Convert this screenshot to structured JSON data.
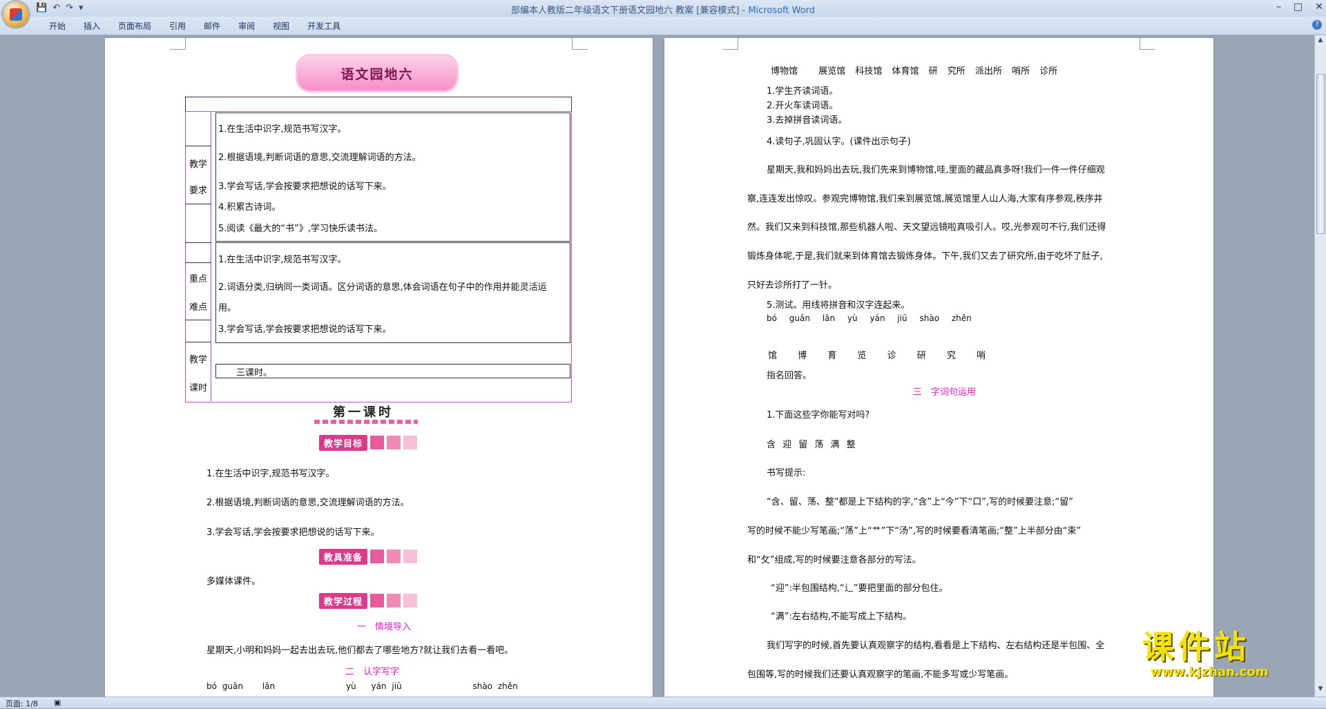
{
  "window": {
    "title": "部编本人教版二年级语文下册语文园地六 教案 [兼容模式]",
    "app": "Microsoft Word",
    "separator": "-",
    "controls": {
      "minimize": "–",
      "maximize": "□",
      "close": "✕"
    }
  },
  "quick_access": {
    "save": "💾",
    "undo": "↶",
    "redo": "↷",
    "customize": "▾"
  },
  "ribbon": {
    "tabs": [
      "开始",
      "插入",
      "页面布局",
      "引用",
      "邮件",
      "审阅",
      "视图",
      "开发工具"
    ],
    "help": "?"
  },
  "page1": {
    "banner": "语文园地六",
    "table": {
      "req_label_1": "教学",
      "req_label_2": "要求",
      "req_items": [
        "1.在生活中识字,规范书写汉字。",
        "2.根据语境,判断词语的意思,交流理解词语的方法。",
        "3.学会写话,学会按要求把想说的话写下来。",
        "4.积累古诗词。",
        "5.阅读《最大的“书”》,学习快乐读书法。"
      ],
      "key_label_1": "重点",
      "key_label_2": "难点",
      "key_items": [
        "1.在生活中识字,规范书写汉字。",
        "2.词语分类,归纳同一类词语。区分词语的意思,体会词语在句子中的作用并能灵活运",
        "用。",
        "3.学会写话,学会按要求把想说的话写下来。"
      ],
      "time_label_1": "教学",
      "time_label_2": "课时",
      "time_value": "三课时。"
    },
    "lesson_title": "第一课时",
    "tag_goal": "教学目标",
    "goals": [
      "1.在生活中识字,规范书写汉字。",
      "2.根据语境,判断词语的意思,交流理解词语的方法。",
      "3.学会写话,学会按要求把想说的话写下来。"
    ],
    "tag_prep": "教具准备",
    "prep": "多媒体课件。",
    "tag_process": "教学过程",
    "section1": "一　情境导入",
    "intro": "星期天,小明和妈妈一起去出去玩,他们都去了哪些地方?就让我们去看一看吧。",
    "section2": "二　认字写字",
    "pinyin": [
      "bó",
      "guǎn",
      "lǎn",
      "yù",
      "yán jiū",
      "shào",
      "zhěn"
    ]
  },
  "page2": {
    "places": [
      "博物馆",
      "展览馆",
      "科技馆",
      "体育馆",
      "研 究所",
      "派出所",
      "哨所",
      "诊所"
    ],
    "reads": [
      "1.学生齐读词语。",
      "2.开火车读词语。",
      "3.去掉拼音读词语。"
    ],
    "step4": "4.读句子,巩固认字。(课件出示句子)",
    "story": [
      "星期天,我和妈妈出去玩,我们先来到博物馆,哇,里面的藏品真多呀!我们一件一件仔细观",
      "察,连连发出惊叹。参观完博物馆,我们来到展览馆,展览馆里人山人海,大家有序参观,秩序井",
      "然。我们又来到科技馆,那些机器人啦、天文望远镜啦真吸引人。哎,光参观可不行,我们还得",
      "锻炼身体呢,于是,我们就来到体育馆去锻炼身体。下午,我们又去了研究所,由于吃坏了肚子,",
      "只好去诊所打了一针。"
    ],
    "step5": "5.测试。用线将拼音和汉字连起来。",
    "test_pinyin": [
      "bó",
      "guǎn",
      "lǎn",
      "yù",
      "yán",
      "jiū",
      "shào",
      "zhěn"
    ],
    "test_chars": [
      "馆",
      "博",
      "育",
      "览",
      "诊",
      "研",
      "究",
      "哨"
    ],
    "answer": "指名回答。",
    "section3": "三　字词句运用",
    "q1": "1.下面这些字你能写对吗?",
    "chars": "含 迎 留 荡 满 整",
    "hint_label": "书写提示:",
    "hint": [
      "“含、留、荡、整”都是上下结构的字,“含”上“今”下“口”,写的时候要注意;“留”",
      "写的时候不能少写笔画;“荡”上“艹”下“汤”,写的时候要看清笔画;“整”上半部分由“束”",
      "和“攵”组成,写的时候要注意各部分的写法。"
    ],
    "ying": "“迎”:半包围结构,“辶”要把里面的部分包住。",
    "man": "“满”:左右结构,不能写成上下结构。",
    "summary": [
      "我们写字的时候,首先要认真观察字的结构,看看是上下结构、左右结构还是半包围、全",
      "包围等,写的时候我们还要认真观察字的笔画,不能多写或少写笔画。"
    ]
  },
  "paragraph_mark": "↵",
  "status": {
    "page": "页面: 1/8"
  },
  "watermark": {
    "text": "课件站",
    "url": "www.kjzhan.com"
  }
}
